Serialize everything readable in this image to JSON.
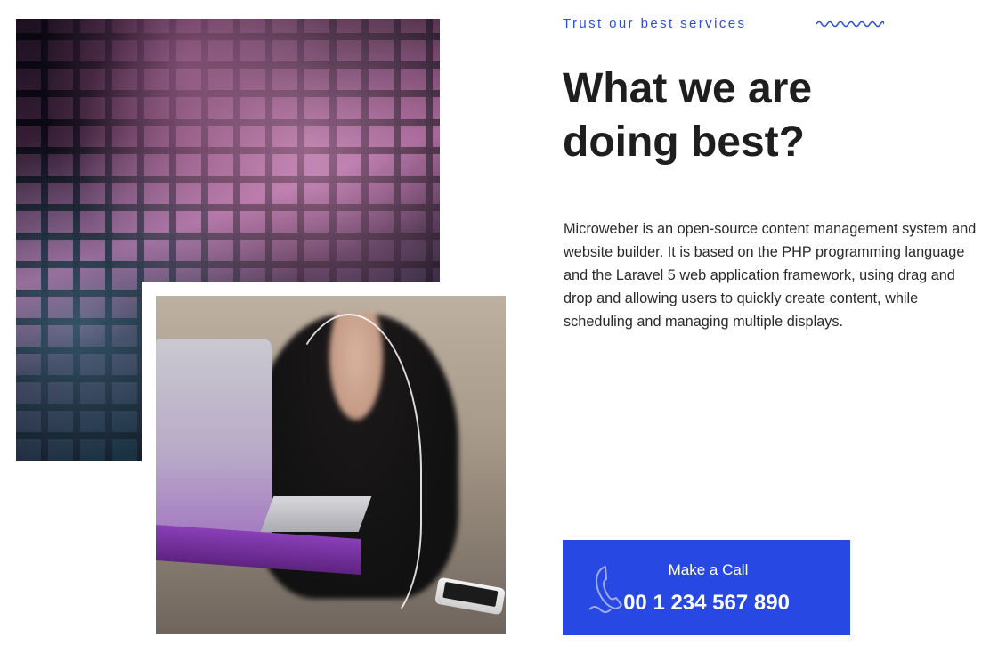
{
  "section": {
    "eyebrow": "Trust our best services",
    "heading": "What we are doing best?",
    "description": "Microweber is an open-source content management system and website builder. It is based on the PHP programming language and the Laravel 5 web application framework, using drag and drop and allowing users to quickly create content, while scheduling and managing multiple displays."
  },
  "cta": {
    "label": "Make a Call",
    "phone": "00 1 234 567 890",
    "icon": "phone-icon"
  },
  "images": {
    "primary": "night-office-building-photo",
    "secondary": "woman-with-laptop-photo"
  },
  "colors": {
    "accent": "#2a4fd8",
    "cta_background": "#2748e2",
    "heading": "#1e1e1e",
    "body": "#2a2a2a"
  }
}
